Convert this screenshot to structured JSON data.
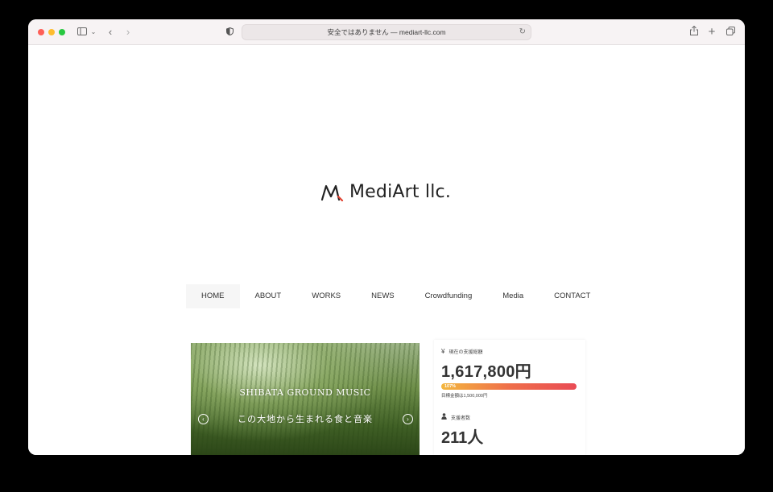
{
  "browser": {
    "address_text": "安全ではありません — mediart-llc.com",
    "icons": [
      "sidebar-icon",
      "chevron-down-icon",
      "back-icon",
      "forward-icon",
      "shield-icon",
      "reload-icon",
      "share-icon",
      "new-tab-icon",
      "tabs-overview-icon"
    ]
  },
  "site": {
    "logo_text": "MediArt llc."
  },
  "nav": {
    "items": [
      {
        "label": "HOME"
      },
      {
        "label": "ABOUT"
      },
      {
        "label": "WORKS"
      },
      {
        "label": "NEWS"
      },
      {
        "label": "Crowdfunding"
      },
      {
        "label": "Media"
      },
      {
        "label": "CONTACT"
      }
    ]
  },
  "hero": {
    "title": "SHIBATA GROUND MUSIC",
    "subtitle": "この大地から生まれる食と音楽"
  },
  "funding": {
    "amount_label": "現在の支援総額",
    "amount": "1,617,800円",
    "progress_label": "107%",
    "progress_percent": 107,
    "goal_text": "目標金額は1,500,000円",
    "supporters_label": "支援者数",
    "supporters": "211人"
  },
  "colors": {
    "progress_start": "#f3b63e",
    "progress_end": "#e94b55",
    "logo_accent": "#e0402f"
  }
}
